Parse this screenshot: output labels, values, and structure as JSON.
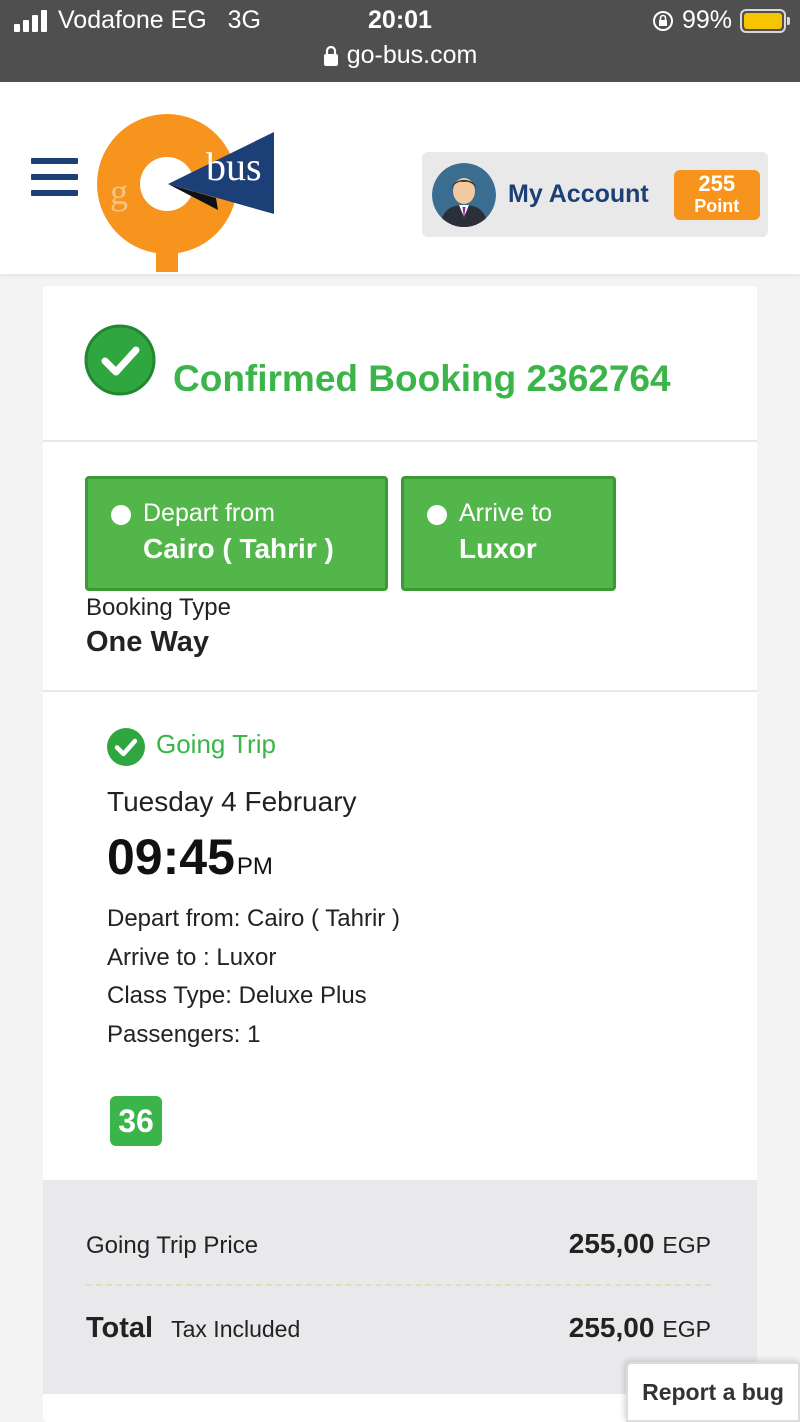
{
  "status_bar": {
    "carrier": "Vodafone EG",
    "network": "3G",
    "time": "20:01",
    "battery": "99%",
    "url": "go-bus.com"
  },
  "header": {
    "logo_text_left": "g",
    "logo_text_right": "bus",
    "account_label": "My Account",
    "points_value": "255",
    "points_unit": "Point"
  },
  "confirmation": {
    "title": "Confirmed Booking 2362764"
  },
  "route": {
    "depart_label": "Depart from",
    "depart_value": "Cairo ( Tahrir )",
    "arrive_label": "Arrive to",
    "arrive_value": "Luxor",
    "booking_type_label": "Booking Type",
    "booking_type_value": "One Way"
  },
  "trip": {
    "title": "Going Trip",
    "date": "Tuesday 4 February",
    "time": "09:45",
    "ampm": "PM",
    "details": [
      "Depart from: Cairo ( Tahrir )",
      "Arrive to : Luxor",
      "Class Type: Deluxe Plus",
      "Passengers: 1"
    ],
    "seat": "36"
  },
  "pricing": {
    "going_label": "Going Trip Price",
    "going_amount": "255,00",
    "currency": "EGP",
    "total_label": "Total",
    "tax_label": "Tax Included",
    "total_amount": "255,00"
  },
  "report_bug_label": "Report a bug",
  "colors": {
    "brand_green": "#3bb54a",
    "brand_navy": "#1d3f77",
    "brand_orange": "#f7941d"
  }
}
